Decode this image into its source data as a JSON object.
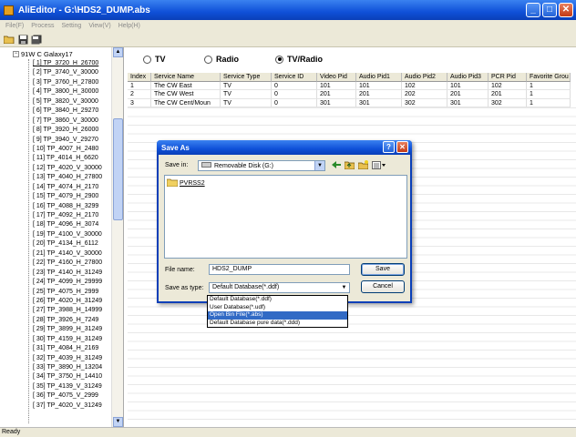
{
  "window": {
    "title": "AliEditor - G:\\HDS2_DUMP.abs",
    "min": "_",
    "max": "□",
    "close": "✕"
  },
  "menu": [
    "File(F)",
    "Process",
    "Setting",
    "View(V)",
    "Help(H)"
  ],
  "tree": {
    "root_label": "91W C Galaxy17",
    "items": [
      "[ 1] TP_3720_H_26700",
      "[ 2] TP_3740_V_30000",
      "[ 3] TP_3760_H_27800",
      "[ 4] TP_3800_H_30000",
      "[ 5] TP_3820_V_30000",
      "[ 6] TP_3840_H_29270",
      "[ 7] TP_3860_V_30000",
      "[ 8] TP_3920_H_26000",
      "[ 9] TP_3940_V_29270",
      "[ 10] TP_4007_H_2480",
      "[ 11] TP_4014_H_6620",
      "[ 12] TP_4020_V_30000",
      "[ 13] TP_4040_H_27800",
      "[ 14] TP_4074_H_2170",
      "[ 15] TP_4079_H_2900",
      "[ 16] TP_4088_H_3299",
      "[ 17] TP_4092_H_2170",
      "[ 18] TP_4096_H_3074",
      "[ 19] TP_4100_V_30000",
      "[ 20] TP_4134_H_6112",
      "[ 21] TP_4140_V_30000",
      "[ 22] TP_4160_H_27800",
      "[ 23] TP_4140_H_31249",
      "[ 24] TP_4099_H_29999",
      "[ 25] TP_4075_H_2999",
      "[ 26] TP_4020_H_31249",
      "[ 27] TP_3988_H_14999",
      "[ 28] TP_3926_H_7249",
      "[ 29] TP_3899_H_31249",
      "[ 30] TP_4159_H_31249",
      "[ 31] TP_4084_H_2169",
      "[ 32] TP_4039_H_31249",
      "[ 33] TP_3890_H_13204",
      "[ 34] TP_3750_H_14410",
      "[ 35] TP_4139_V_31249",
      "[ 36] TP_4075_V_2999",
      "[ 37] TP_4020_V_31249"
    ]
  },
  "radios": [
    {
      "label": "TV",
      "checked": false
    },
    {
      "label": "Radio",
      "checked": false
    },
    {
      "label": "TV/Radio",
      "checked": true
    }
  ],
  "table": {
    "columns": [
      "Index",
      "Service Name",
      "Service Type",
      "Service ID",
      "Video Pid",
      "Audio Pid1",
      "Audio Pid2",
      "Audio Pid3",
      "PCR Pid",
      "Favorite Grou"
    ],
    "rows": [
      [
        "1",
        "The CW East",
        "TV",
        "0",
        "101",
        "101",
        "102",
        "101",
        "102",
        "1"
      ],
      [
        "2",
        "The CW West",
        "TV",
        "0",
        "201",
        "201",
        "202",
        "201",
        "201",
        "1"
      ],
      [
        "3",
        "The CW Cent/Moun",
        "TV",
        "0",
        "301",
        "301",
        "302",
        "301",
        "302",
        "1"
      ]
    ]
  },
  "dialog": {
    "title": "Save As",
    "help": "?",
    "close": "✕",
    "save_in_label": "Save in:",
    "save_in_value": "Removable Disk (G:)",
    "folder": "PVRSS2",
    "file_name_label": "File name:",
    "file_name_value": "HDS2_DUMP",
    "save_type_label": "Save as type:",
    "save_type_value": "Default Database(*.ddf)",
    "save_button": "Save",
    "cancel_button": "Cancel",
    "type_options": [
      "Default Database(*.ddf)",
      "User Database(*.udf)",
      "Open Bin File(*.abs)",
      "Default Database pure data(*.ddd)"
    ],
    "selected_option_index": 2
  },
  "status": {
    "text": "Ready"
  },
  "colors": {
    "titlebar": "#0f50d8",
    "selection": "#316ac5",
    "window_bg": "#ece9d8"
  }
}
